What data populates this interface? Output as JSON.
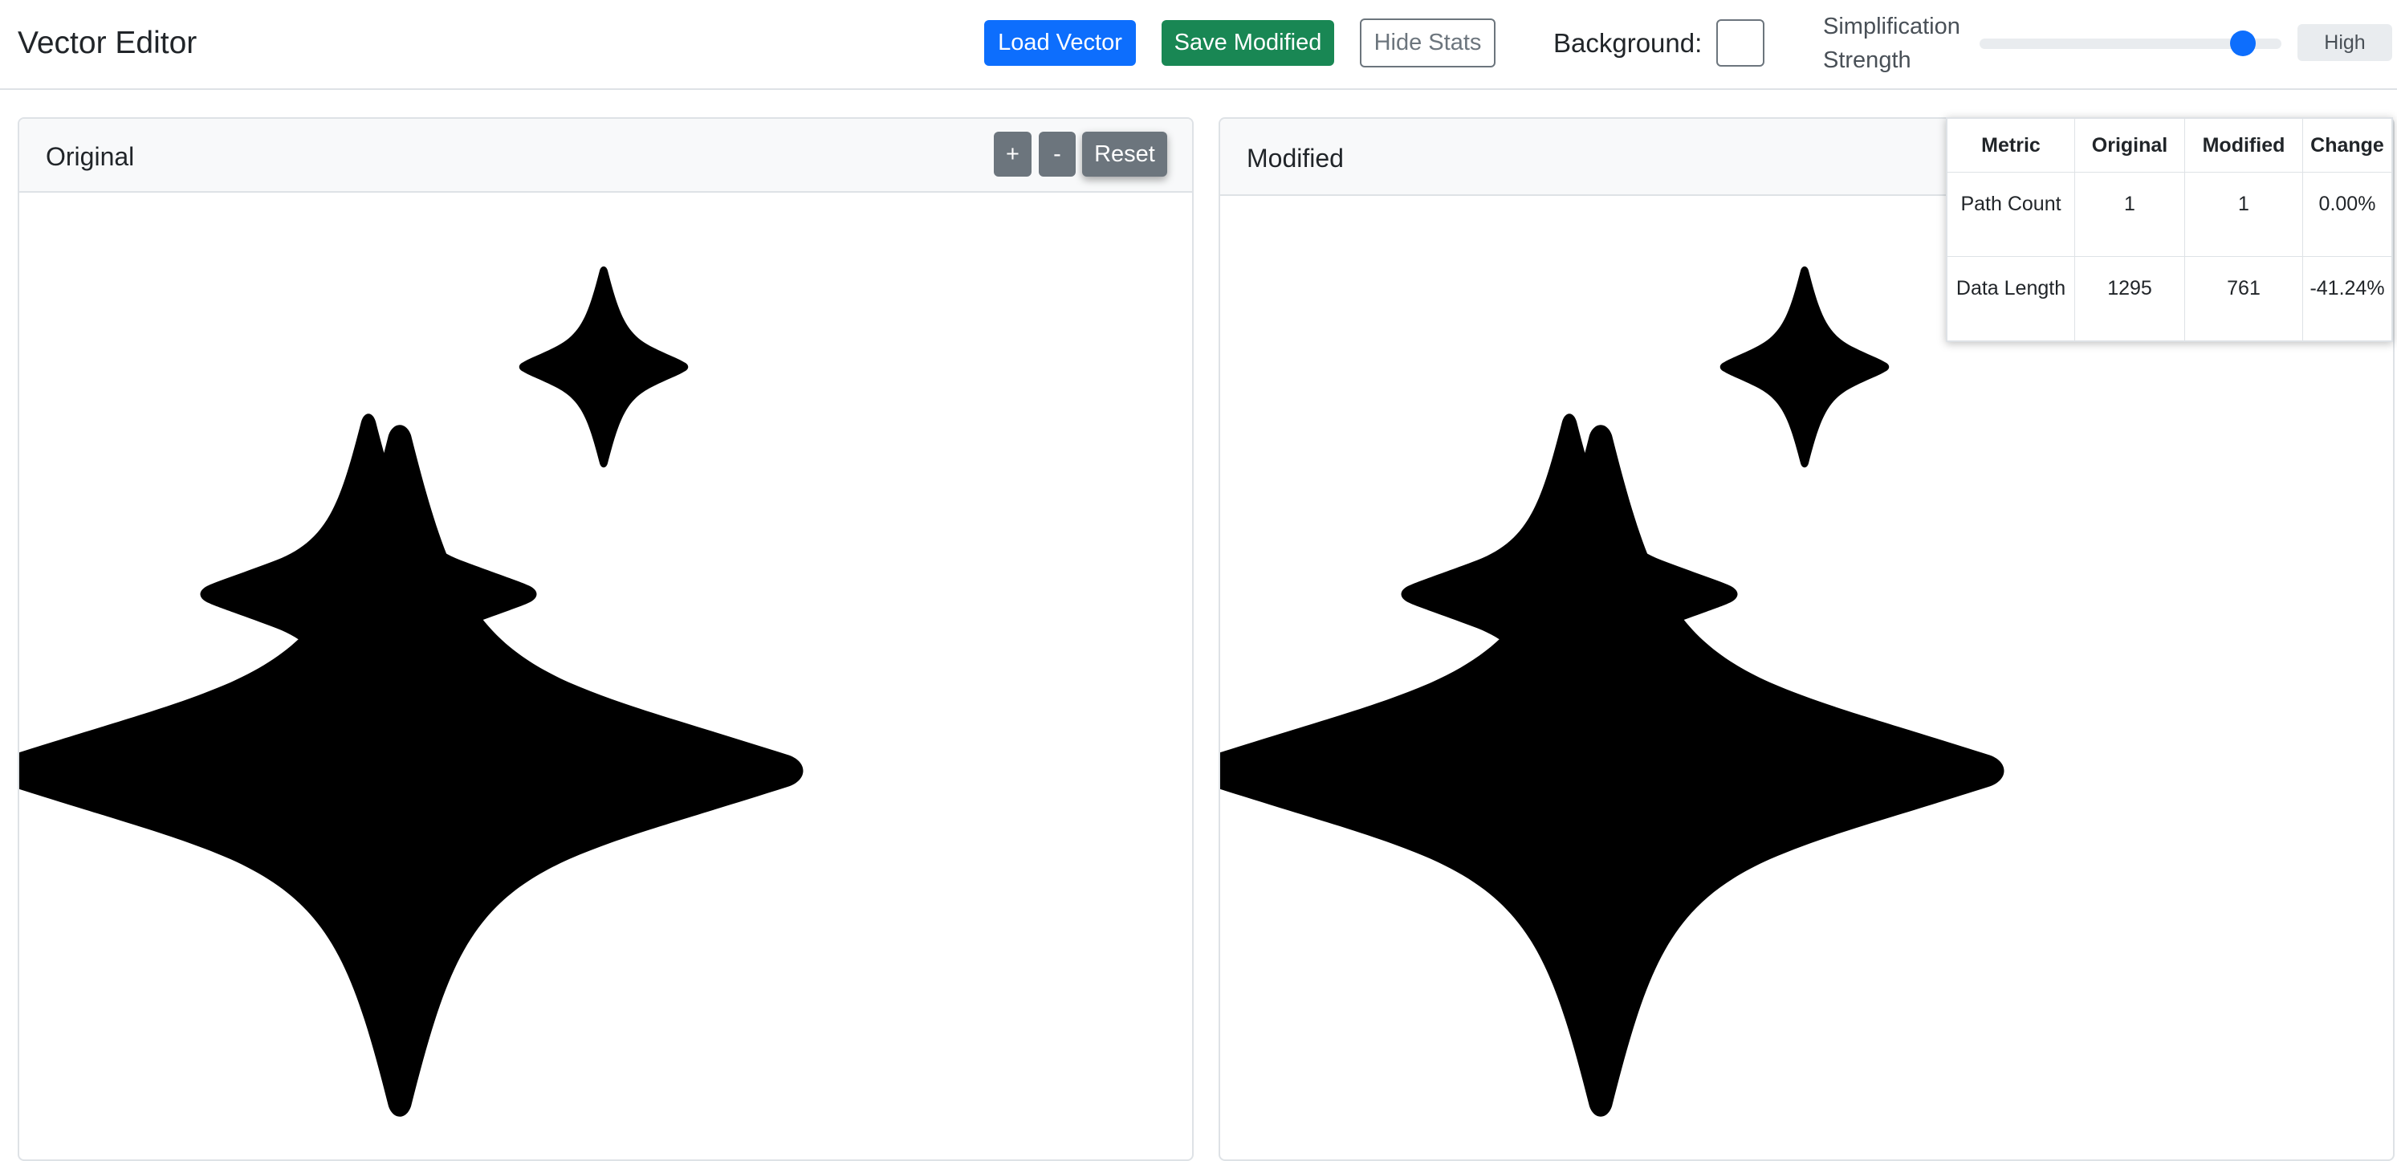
{
  "header": {
    "title": "Vector Editor",
    "load_label": "Load Vector",
    "save_label": "Save Modified",
    "stats_toggle_label": "Hide Stats",
    "background_label": "Background:",
    "background_color": "#ffffff",
    "simplification_label": "Simplification Strength",
    "simplification_value": 0.82,
    "simplification_level": "High"
  },
  "panels": {
    "original": {
      "title": "Original",
      "zoom_in": "+",
      "zoom_out": "-",
      "reset": "Reset"
    },
    "modified": {
      "title": "Modified"
    }
  },
  "stats": {
    "headers": [
      "Metric",
      "Original",
      "Modified",
      "Change"
    ],
    "rows": [
      {
        "metric": "Path Count",
        "original": "1",
        "modified": "1",
        "change": "0.00%"
      },
      {
        "metric": "Data Length",
        "original": "1295",
        "modified": "761",
        "change": "-41.24%"
      }
    ]
  },
  "colors": {
    "primary": "#0d6efd",
    "success": "#198754",
    "secondary": "#6c757d",
    "shape_fill": "#000000"
  },
  "icons": [
    "sparkles-icon"
  ]
}
